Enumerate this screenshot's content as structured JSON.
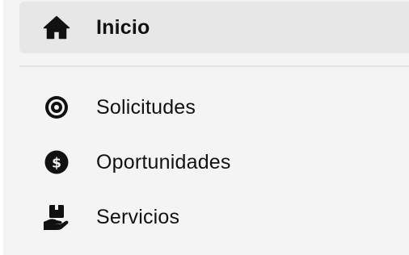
{
  "sidebar": {
    "items": [
      {
        "label": "Inicio",
        "icon": "home-icon",
        "active": true
      },
      {
        "label": "Solicitudes",
        "icon": "target-icon",
        "active": false
      },
      {
        "label": "Oportunidades",
        "icon": "dollar-coin-icon",
        "active": false
      },
      {
        "label": "Servicios",
        "icon": "hand-holding-box-icon",
        "active": false
      }
    ]
  },
  "colors": {
    "panel_background": "#f4f4f4",
    "active_background": "#e7e7e7",
    "divider": "#e2e2e2",
    "text": "#111111"
  }
}
